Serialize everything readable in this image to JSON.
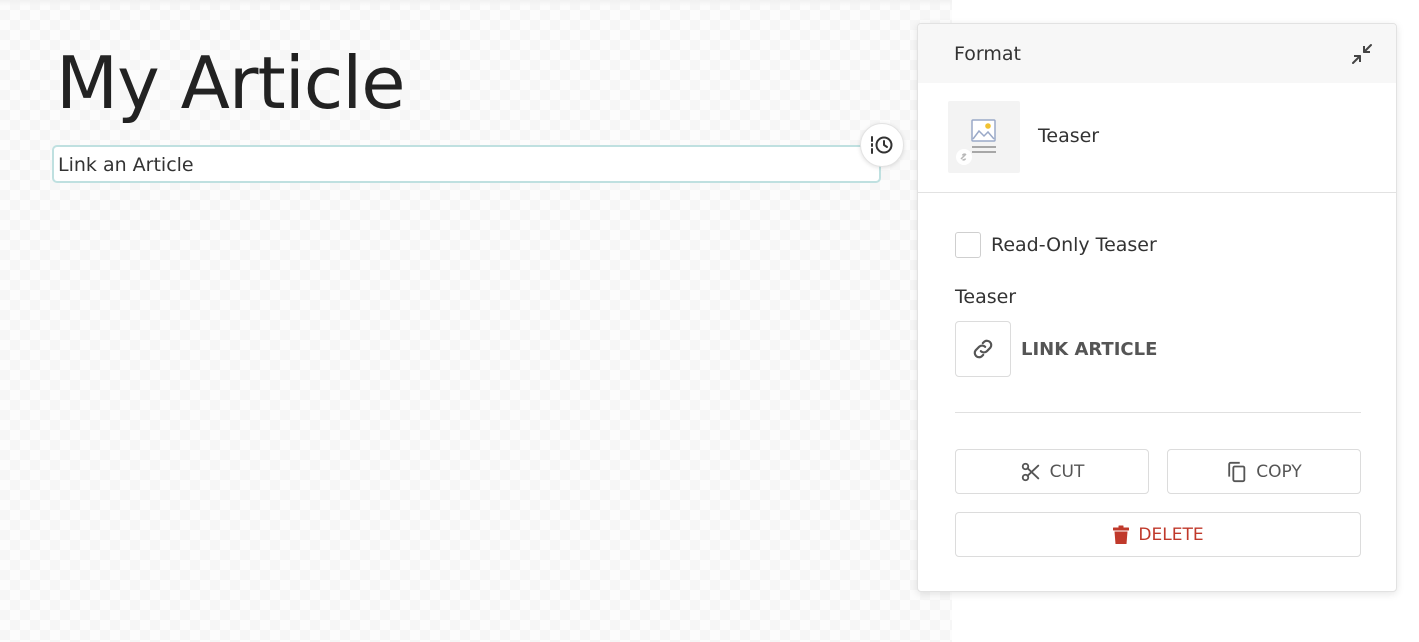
{
  "editor": {
    "title": "My Article",
    "link_block_text": "Link an Article"
  },
  "panel": {
    "title": "Format",
    "block_type_label": "Teaser",
    "readonly_label": "Read-Only Teaser",
    "readonly_checked": false,
    "teaser_section_label": "Teaser",
    "link_article_label": "LINK ARTICLE",
    "cut_label": "CUT",
    "copy_label": "COPY",
    "delete_label": "DELETE"
  },
  "icons": {
    "history": "history-icon",
    "collapse": "collapse-icon",
    "teaser": "teaser-image-icon",
    "link": "link-icon",
    "cut": "scissors-icon",
    "copy": "copy-icon",
    "delete": "trash-icon"
  },
  "colors": {
    "selection_border": "#bfe0e0",
    "delete_red": "#c0392b",
    "panel_header_bg": "#f7f7f7"
  }
}
